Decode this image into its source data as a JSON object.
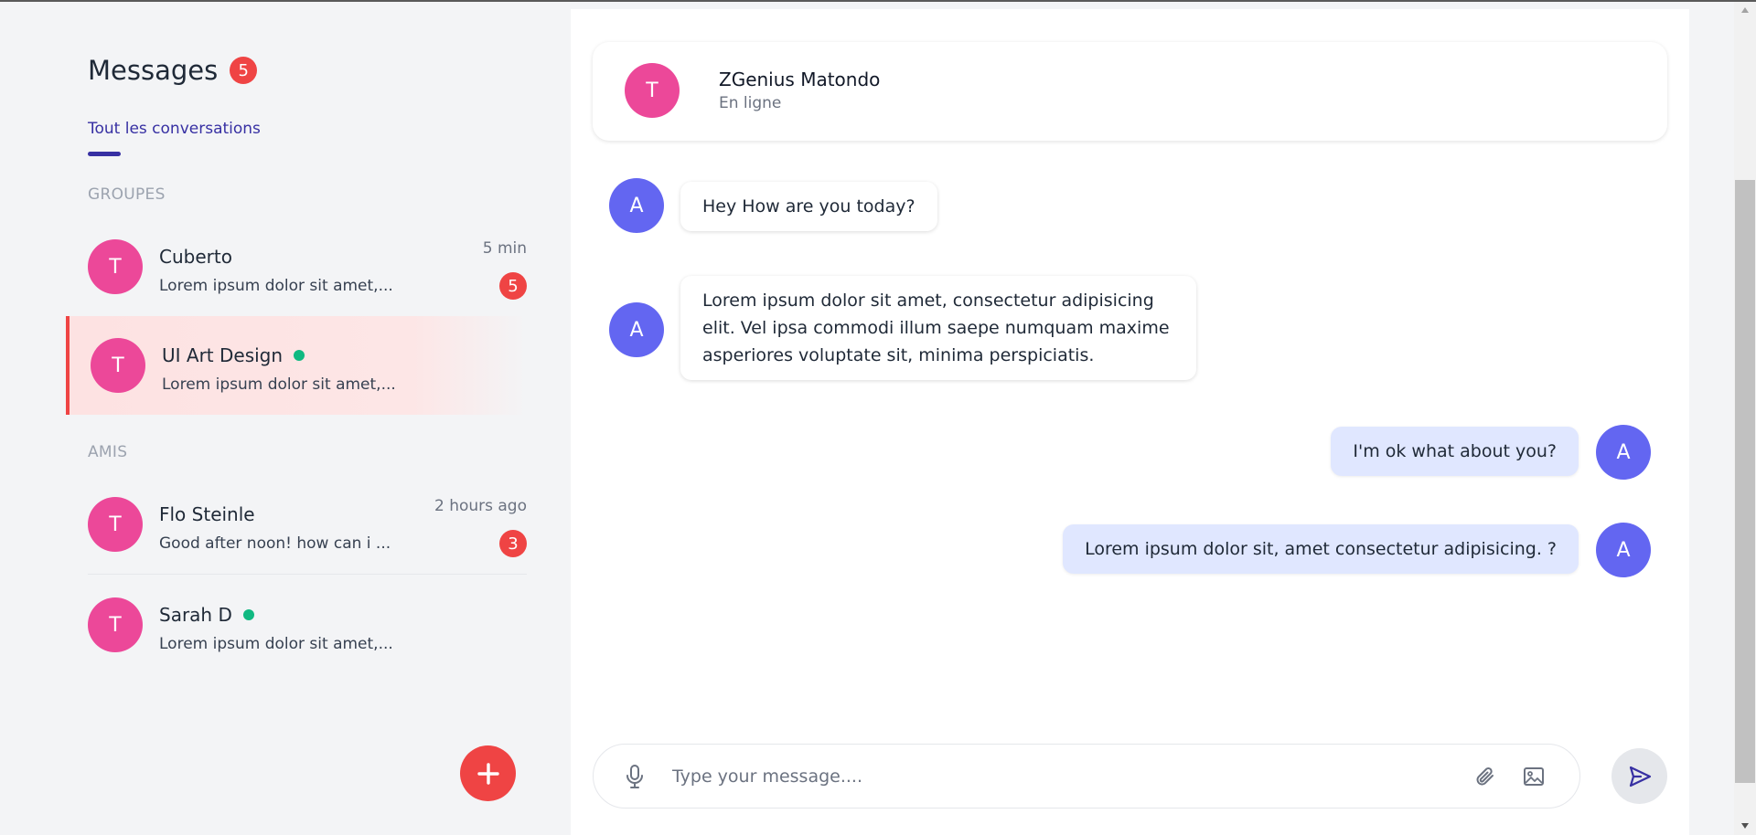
{
  "sidebar": {
    "title": "Messages",
    "unread_total": "5",
    "tab_label": "Tout les conversations",
    "sections": {
      "groups_label": "GROUPES",
      "friends_label": "AMIS"
    },
    "conversations": [
      {
        "initial": "T",
        "name": "Cuberto",
        "preview": "Lorem ipsum dolor sit amet,...",
        "time": "5 min",
        "unread": "5"
      },
      {
        "initial": "T",
        "name": "UI Art Design",
        "preview": "Lorem ipsum dolor sit amet,...",
        "online": true,
        "active": true
      },
      {
        "initial": "T",
        "name": "Flo Steinle",
        "preview": "Good after noon! how can i ...",
        "time": "2 hours ago",
        "unread": "3"
      },
      {
        "initial": "T",
        "name": "Sarah D",
        "preview": "Lorem ipsum dolor sit amet,...",
        "online": true
      }
    ],
    "new_conversation_icon": "plus-icon"
  },
  "chat": {
    "contact": {
      "initial": "T",
      "name": "ZGenius Matondo",
      "status": "En ligne"
    },
    "messages": [
      {
        "direction": "in",
        "initial": "A",
        "text": "Hey How are you today?"
      },
      {
        "direction": "in",
        "initial": "A",
        "text": "Lorem ipsum dolor sit amet, consectetur adipisicing elit. Vel ipsa commodi illum saepe numquam maxime asperiores voluptate sit, minima perspiciatis."
      },
      {
        "direction": "out",
        "initial": "A",
        "text": "I'm ok what about you?"
      },
      {
        "direction": "out",
        "initial": "A",
        "text": "Lorem ipsum dolor sit, amet consectetur adipisicing. ?"
      }
    ],
    "composer": {
      "placeholder": "Type your message....",
      "value": "",
      "icons": [
        "microphone-icon",
        "paperclip-icon",
        "image-icon",
        "send-icon"
      ]
    }
  },
  "colors": {
    "accent": "#3730a3",
    "badge": "#ef4444",
    "avatar_contact": "#ec4899",
    "avatar_user": "#6366f1",
    "online": "#10b981",
    "outgoing_bubble": "#e0e7ff"
  }
}
